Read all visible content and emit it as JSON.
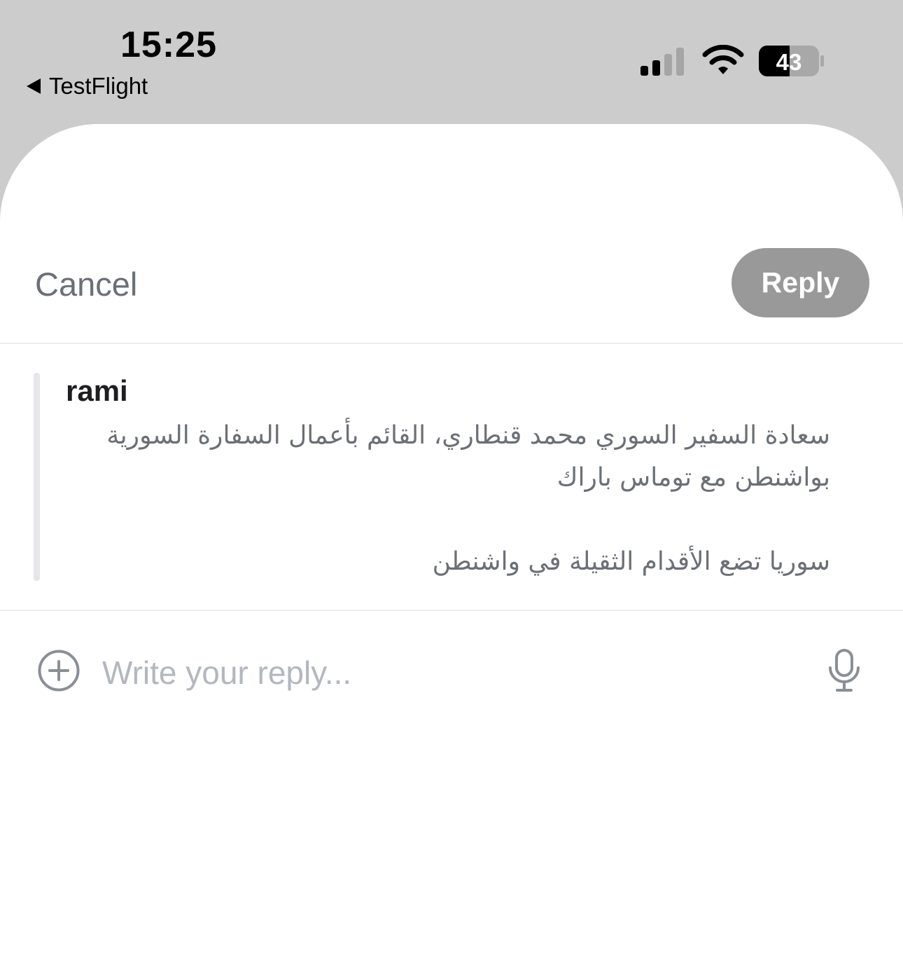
{
  "status_bar": {
    "time": "15:25",
    "back_label": "TestFlight",
    "battery_level": "43",
    "signal_bars_active": 2,
    "signal_bars_total": 4
  },
  "toolbar": {
    "cancel_label": "Cancel",
    "reply_label": "Reply"
  },
  "quoted_message": {
    "author": "rami",
    "line1": "سعادة السفير السوري محمد قنطاري، القائم بأعمال السفارة السورية",
    "line2": "بواشنطن مع توماس باراك",
    "line3": "سوريا تضع الأقدام الثقيلة في واشنطن"
  },
  "composer": {
    "placeholder": "Write your reply..."
  },
  "icons": {
    "back": "back-arrow-icon",
    "signal": "signal-icon",
    "wifi": "wifi-icon",
    "battery": "battery-icon",
    "add": "plus-circle-icon",
    "mic": "microphone-icon"
  },
  "colors": {
    "reply_button_bg": "#999999",
    "secondary_text": "#6b6f76",
    "placeholder": "#b3b7be"
  }
}
